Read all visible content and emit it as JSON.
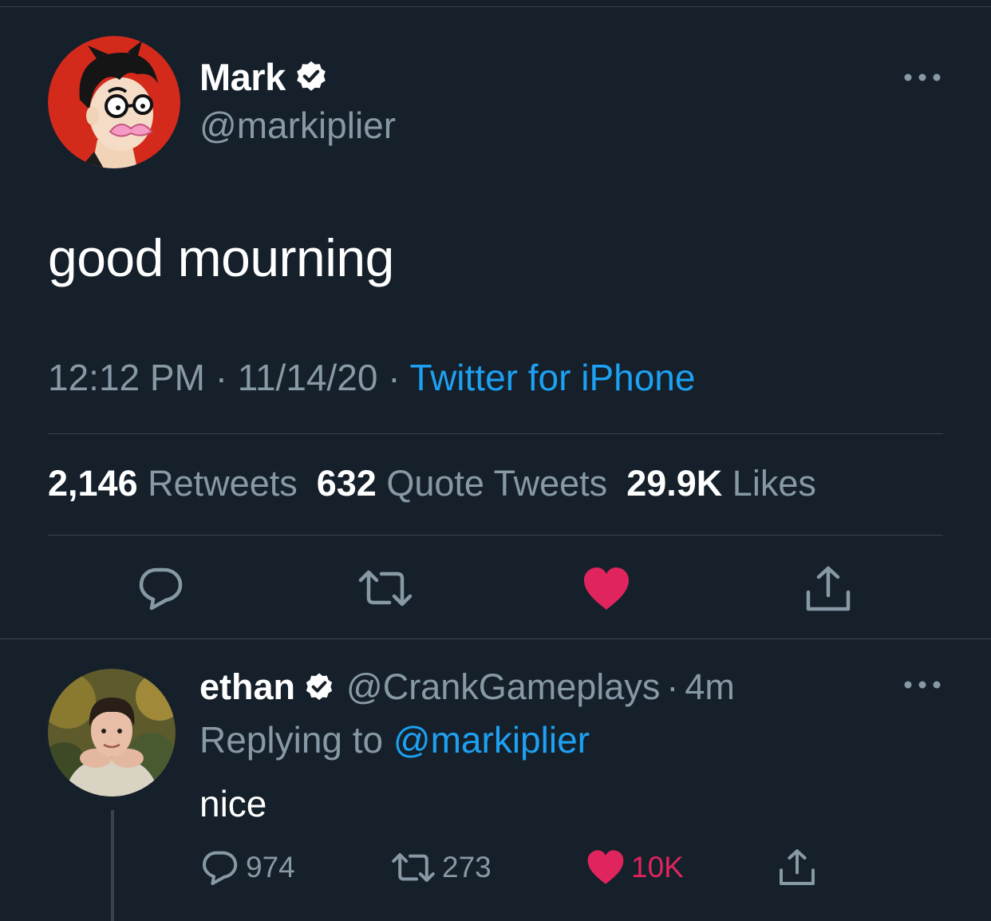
{
  "colors": {
    "background": "#15202b",
    "divider": "#38444d",
    "secondary_text": "#8899a6",
    "link": "#1da1f2",
    "like": "#e0245e"
  },
  "main_tweet": {
    "author": {
      "name": "Mark",
      "handle": "@markiplier",
      "verified": true,
      "avatar_icon": "cartoon-avatar-icon"
    },
    "text": "good mourning",
    "meta": {
      "time": "12:12 PM",
      "date": "11/14/20",
      "separator": "·",
      "source": "Twitter for iPhone"
    },
    "stats": {
      "retweets_count": "2,146",
      "retweets_label": "Retweets",
      "quotes_count": "632",
      "quotes_label": "Quote Tweets",
      "likes_count": "29.9K",
      "likes_label": "Likes"
    },
    "actions": [
      "reply-icon",
      "retweet-icon",
      "like-icon",
      "share-icon"
    ],
    "liked": true
  },
  "reply": {
    "author": {
      "name": "ethan",
      "handle": "@CrankGameplays",
      "verified": true,
      "time": "4m",
      "separator": "·",
      "avatar_icon": "photo-avatar-icon"
    },
    "replying_prefix": "Replying to",
    "replying_to": "@markiplier",
    "text": "nice",
    "counts": {
      "replies": "974",
      "retweets": "273",
      "likes": "10K"
    },
    "liked": true
  }
}
